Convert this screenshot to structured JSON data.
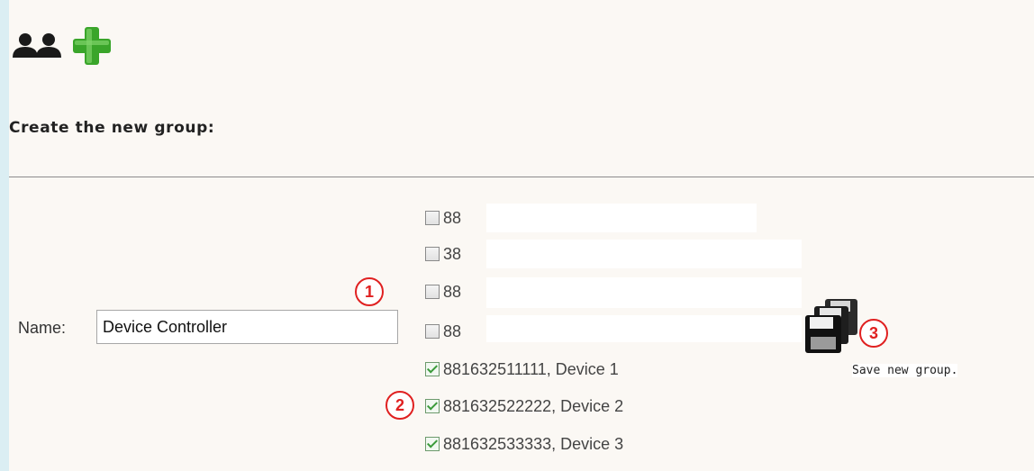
{
  "header": {
    "icon": "add-group-icon",
    "title": "Create the new group:"
  },
  "form": {
    "name_label": "Name:",
    "name_value": "Device Controller"
  },
  "devices": [
    {
      "label": "88",
      "checked": false
    },
    {
      "label": "38",
      "checked": false
    },
    {
      "label": "88",
      "checked": false
    },
    {
      "label": "88",
      "checked": false
    },
    {
      "label": "881632511111, Device 1",
      "checked": true
    },
    {
      "label": "881632522222, Device 2",
      "checked": true
    },
    {
      "label": "881632533333, Device 3",
      "checked": true
    }
  ],
  "save": {
    "icon": "floppy-disks-icon",
    "label": "Save new group."
  },
  "callouts": [
    "1",
    "2",
    "3"
  ],
  "colors": {
    "background": "#dbeef3",
    "panel": "#fbf8f4",
    "callout": "#e02020",
    "check": "#3a9a3a"
  }
}
